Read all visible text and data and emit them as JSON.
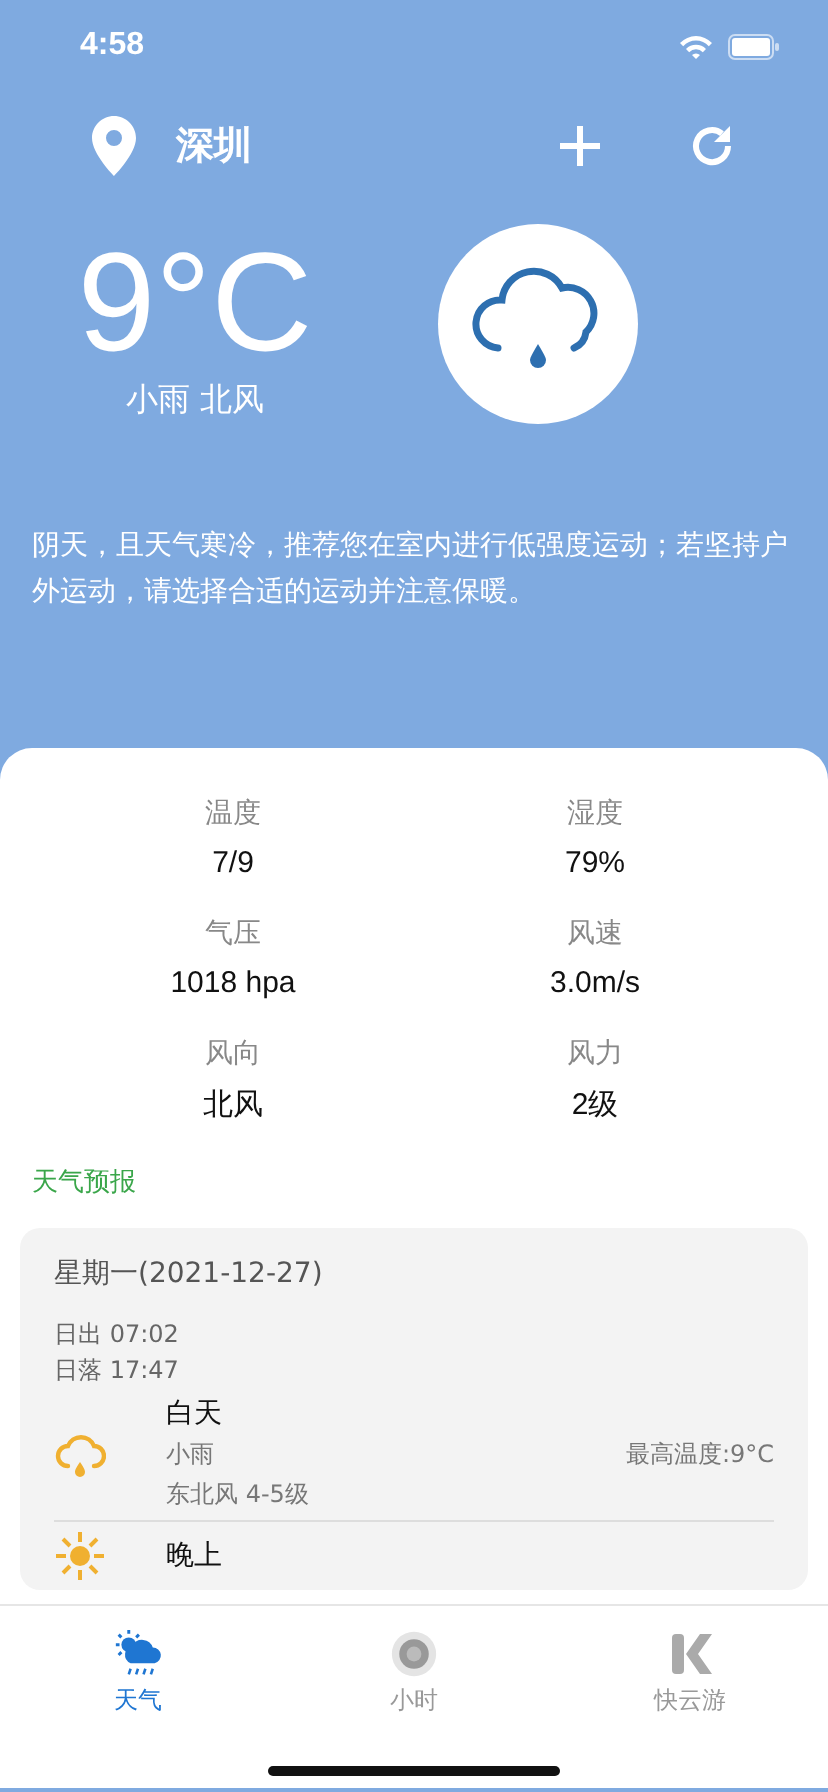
{
  "status_bar": {
    "time": "4:58"
  },
  "header": {
    "city": "深圳"
  },
  "current": {
    "temperature": "9°C",
    "summary": "小雨 北风"
  },
  "advice": "阴天，且天气寒冷，推荐您在室内进行低强度运动；若坚持户外运动，请选择合适的运动并注意保暖。",
  "stats": [
    {
      "label": "温度",
      "value": "7/9"
    },
    {
      "label": "湿度",
      "value": "79%"
    },
    {
      "label": "气压",
      "value": "1018 hpa"
    },
    {
      "label": "风速",
      "value": "3.0m/s"
    },
    {
      "label": "风向",
      "value": "北风"
    },
    {
      "label": "风力",
      "value": "2级"
    }
  ],
  "forecast_title": "天气预报",
  "forecast": {
    "date": "星期一(2021-12-27)",
    "sunrise": "日出 07:02",
    "sunset": "日落 17:47",
    "periods": [
      {
        "kind": "rain",
        "name": "白天",
        "weather": "小雨",
        "wind": "东北风 4-5级",
        "high": "最高温度:9°C"
      },
      {
        "kind": "sun",
        "name": "晚上"
      }
    ]
  },
  "tabs": [
    {
      "kind": "weather",
      "label": "天气",
      "selected": true
    },
    {
      "kind": "hourly",
      "label": "小时",
      "selected": false
    },
    {
      "kind": "game",
      "label": "快云游",
      "selected": false
    }
  ]
}
